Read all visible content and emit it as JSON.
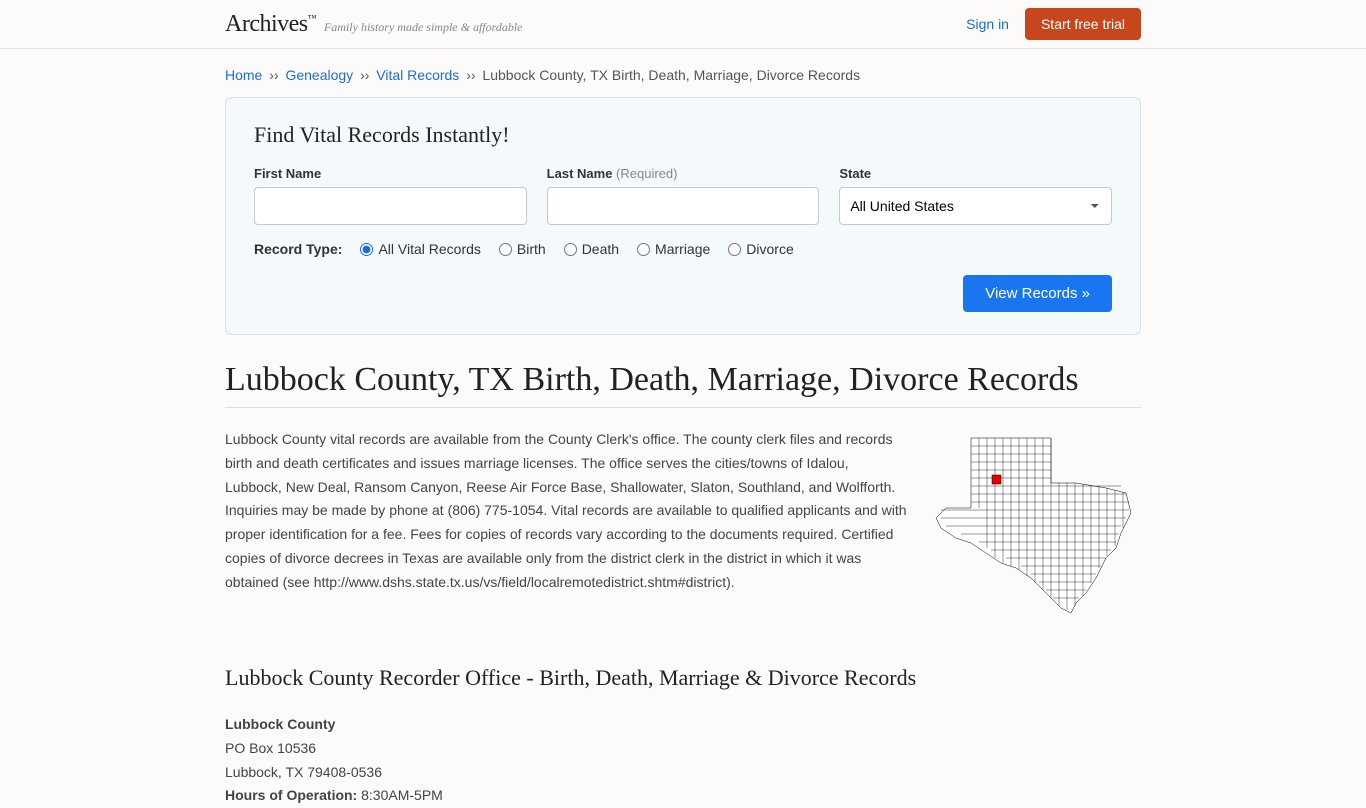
{
  "header": {
    "logo": "Archives",
    "tagline": "Family history made simple & affordable",
    "signin": "Sign in",
    "cta": "Start free trial"
  },
  "breadcrumb": {
    "home": "Home",
    "genealogy": "Genealogy",
    "vital": "Vital Records",
    "current": "Lubbock County, TX Birth, Death, Marriage, Divorce Records",
    "sep": "››"
  },
  "search": {
    "title": "Find Vital Records Instantly!",
    "first_label": "First Name",
    "last_label": "Last Name",
    "last_req": "(Required)",
    "state_label": "State",
    "state_value": "All United States",
    "rt_label": "Record Type:",
    "opts": {
      "all": "All Vital Records",
      "birth": "Birth",
      "death": "Death",
      "marriage": "Marriage",
      "divorce": "Divorce"
    },
    "submit": "View Records »"
  },
  "page": {
    "title": "Lubbock County, TX Birth, Death, Marriage, Divorce Records",
    "intro": "Lubbock County vital records are available from the County Clerk's office. The county clerk files and records birth and death certificates and issues marriage licenses. The office serves the cities/towns of Idalou, Lubbock, New Deal, Ransom Canyon, Reese Air Force Base, Shallowater, Slaton, Southland, and Wolfforth. Inquiries may be made by phone at (806) 775-1054. Vital records are available to qualified applicants and with proper identification for a fee. Fees for copies of records vary according to the documents required. Certified copies of divorce decrees in Texas are available only from the district clerk in the district in which it was obtained (see http://www.dshs.state.tx.us/vs/field/localremotedistrict.shtm#district).",
    "recorder_title": "Lubbock County Recorder Office - Birth, Death, Marriage & Divorce Records"
  },
  "address": {
    "name": "Lubbock County",
    "po": "PO Box 10536",
    "city": "Lubbock, TX 79408-0536",
    "hours_label": "Hours of Operation:",
    "hours": "8:30AM-5PM"
  }
}
